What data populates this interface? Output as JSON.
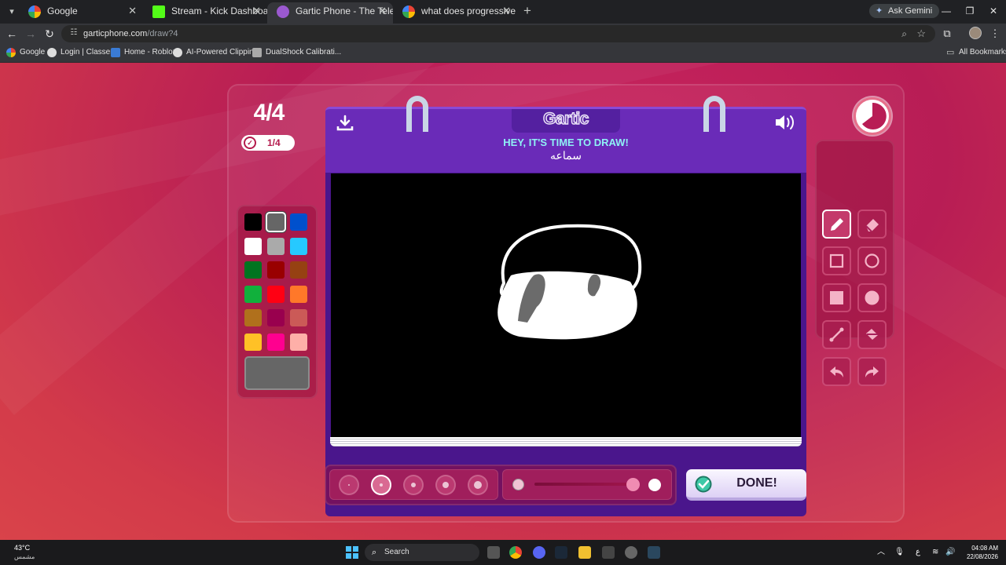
{
  "browser": {
    "tabs": [
      {
        "title": "Google",
        "active": false
      },
      {
        "title": "Stream - Kick Dashboard",
        "active": false
      },
      {
        "title": "Gartic Phone - The Telephone G",
        "active": true
      },
      {
        "title": "what does progressive mean - ",
        "active": false
      }
    ],
    "ask_gemini": "Ask Gemini",
    "url_domain": "garticphone.com",
    "url_path": "/draw?4",
    "bookmarks": [
      "Google",
      "Login | Classera",
      "Home - Roblox",
      "AI-Powered Clippin...",
      "DualShock Calibrati..."
    ],
    "all_bookmarks": "All Bookmarks"
  },
  "game": {
    "round": "4/4",
    "progress": "1/4",
    "logo": "Gartic",
    "instruction": "HEY, IT'S TIME TO DRAW!",
    "prompt": "سماعه",
    "done_label": "DONE!",
    "palette": [
      "#000000",
      "#666666",
      "#0050cd",
      "#ffffff",
      "#aaaaaa",
      "#26c9ff",
      "#017420",
      "#990000",
      "#964112",
      "#11b03c",
      "#ff0013",
      "#ff7829",
      "#b0701c",
      "#99004e",
      "#cb5a57",
      "#ffc126",
      "#ff008f",
      "#feafa8"
    ],
    "selected_color": "#666666",
    "tools": [
      "pencil",
      "eraser",
      "rectangle",
      "circle",
      "filled-rectangle",
      "filled-circle",
      "line",
      "fill-bucket",
      "undo",
      "redo"
    ],
    "active_tool": "pencil",
    "brush_sizes": 5,
    "selected_brush_size_index": 1,
    "opacity_level": 1.0
  },
  "taskbar": {
    "temperature": "43°C",
    "weather": "مشمس",
    "search": "Search",
    "time": "04:08 AM",
    "date": "22/08/2026"
  },
  "colors": {
    "accent_purple": "#6a2bb8",
    "instruction_cyan": "#8ff1f5",
    "page_pink": "#c8245e"
  }
}
